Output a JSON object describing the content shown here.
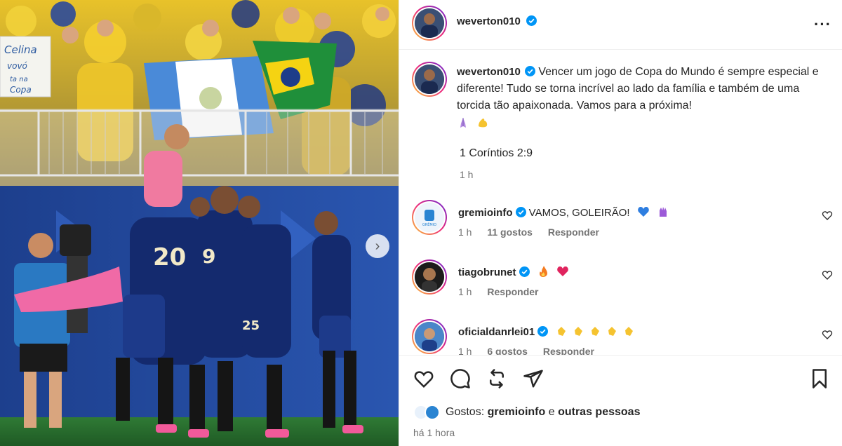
{
  "post": {
    "author": "weverton010",
    "caption": "Vencer um jogo de Copa do Mundo é sempre especial e diferente! Tudo se torna incrível ao lado da família e também de uma torcida tão apaixonada. Vamos para a próxima!",
    "caption_emojis": [
      "praying-hands-emoji",
      "flexed-biceps-emoji"
    ],
    "verse": "1 Coríntios 2:9",
    "caption_time": "1 h"
  },
  "photo": {
    "banner_text": "Celina vovó ta na Copa",
    "jersey_numbers": [
      "20",
      "9",
      "25"
    ]
  },
  "comments": [
    {
      "user": "gremioinfo",
      "text": "VAMOS, GOLEIRÃO!",
      "emojis": [
        "blue-heart-emoji",
        "purple-glove-emoji"
      ],
      "time": "1 h",
      "likes": "11 gostos",
      "reply": "Responder"
    },
    {
      "user": "tiagobrunet",
      "text": "",
      "emojis": [
        "fire-emoji",
        "red-heart-emoji"
      ],
      "time": "1 h",
      "likes": "",
      "reply": "Responder"
    },
    {
      "user": "oficialdanrlei01",
      "text": "",
      "emojis": [
        "clap-emoji",
        "clap-emoji",
        "clap-emoji",
        "clap-emoji",
        "clap-emoji"
      ],
      "time": "1 h",
      "likes": "6 gostos",
      "reply": "Responder"
    }
  ],
  "footer": {
    "likes_prefix": "Gostos:",
    "likes_user": "gremioinfo",
    "likes_connector": "e",
    "likes_others": "outras pessoas",
    "posted_ago": "há 1 hora"
  },
  "colors": {
    "verified": "#0095f6",
    "story_ring": [
      "#f9ce34",
      "#ee2a7b",
      "#6228d7"
    ],
    "text_primary": "#262626",
    "text_secondary": "#737373"
  }
}
